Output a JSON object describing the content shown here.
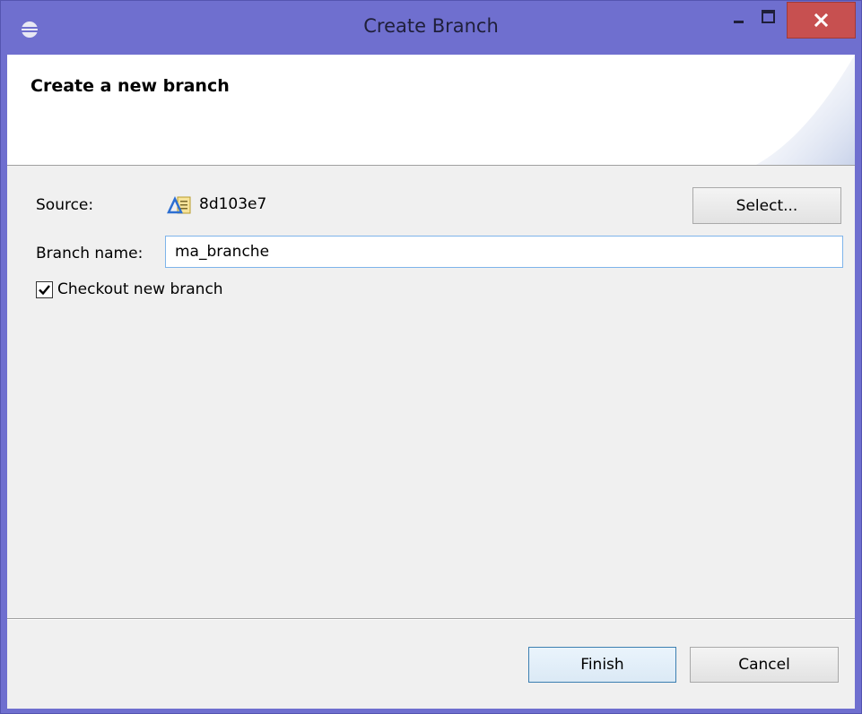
{
  "window": {
    "title": "Create Branch",
    "colors": {
      "titlebar": "#6f6fcf",
      "close_button": "#c75050",
      "client": "#f0f0f0"
    },
    "icons": {
      "app": "eclipse-icon",
      "minimize": "minimize-icon",
      "maximize": "maximize-icon",
      "close": "close-icon"
    }
  },
  "banner": {
    "title": "Create a new branch"
  },
  "form": {
    "source_label": "Source:",
    "source_value": "8d103e7",
    "source_icon": "commit-icon",
    "select_label": "Select...",
    "branch_label": "Branch name:",
    "branch_value": "ma_branche",
    "checkout_label": "Checkout new branch",
    "checkout_checked": true
  },
  "buttons": {
    "finish": "Finish",
    "cancel": "Cancel"
  }
}
